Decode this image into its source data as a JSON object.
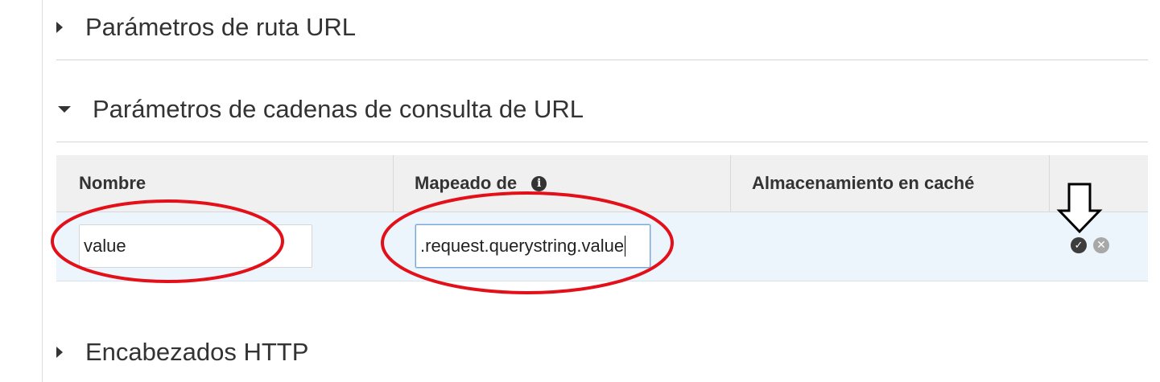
{
  "sections": {
    "url_path": {
      "label": "Parámetros de ruta URL",
      "expanded": false
    },
    "query_strings": {
      "label": "Parámetros de cadenas de consulta de URL",
      "expanded": true
    },
    "http_headers": {
      "label": "Encabezados HTTP",
      "expanded": false
    }
  },
  "table": {
    "columns": [
      "Nombre",
      "Mapeado de",
      "Almacenamiento en caché",
      ""
    ],
    "row": {
      "name_value": "value",
      "mapped_from_value": ".request.querystring.value"
    }
  },
  "icons": {
    "info": "info-circle-icon",
    "confirm": "check-circle-icon",
    "cancel": "x-circle-icon"
  },
  "colors": {
    "annotation_red": "#e3101a",
    "header_bg": "#f0f0f0",
    "row_bg": "#edf5fc"
  }
}
